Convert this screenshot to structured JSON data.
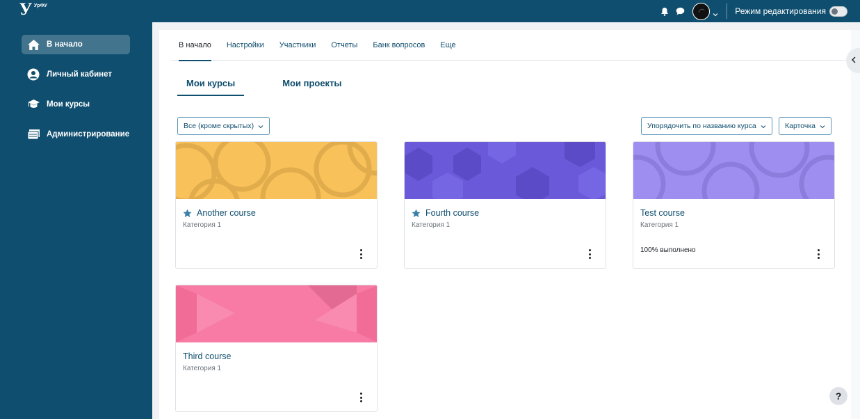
{
  "brand": {
    "mark": "У",
    "name": "УрФУ"
  },
  "topbar": {
    "edit_mode_label": "Режим редактирования"
  },
  "sidebar": {
    "items": [
      {
        "label": "В начало",
        "icon": "home-icon",
        "active": true
      },
      {
        "label": "Личный кабинет",
        "icon": "user-icon",
        "active": false
      },
      {
        "label": "Мои курсы",
        "icon": "graduation-cap-icon",
        "active": false
      },
      {
        "label": "Администрирование",
        "icon": "admin-icon",
        "active": false
      }
    ]
  },
  "secondary_nav": {
    "tabs": [
      {
        "label": "В начало",
        "active": true
      },
      {
        "label": "Настройки",
        "active": false
      },
      {
        "label": "Участники",
        "active": false
      },
      {
        "label": "Отчеты",
        "active": false
      },
      {
        "label": "Банк вопросов",
        "active": false
      },
      {
        "label": "Еще",
        "active": false
      }
    ]
  },
  "subtabs": [
    {
      "label": "Мои курсы",
      "active": true
    },
    {
      "label": "Мои проекты",
      "active": false
    }
  ],
  "filters": {
    "grouping": "Все (кроме скрытых)",
    "sort": "Упорядочить по названию курса",
    "view": "Карточка"
  },
  "courses": [
    {
      "title": "Another course",
      "category": "Категория 1",
      "starred": true,
      "progress": "",
      "color": "#f9c15a"
    },
    {
      "title": "Fourth course",
      "category": "Категория 1",
      "starred": true,
      "progress": "",
      "color": "#6a5ad9"
    },
    {
      "title": "Test course",
      "category": "Категория 1",
      "starred": false,
      "progress": "100% выполнено",
      "color": "#9d8ef0"
    },
    {
      "title": "Third course",
      "category": "Категория 1",
      "starred": false,
      "progress": "",
      "color": "#f77ba4"
    }
  ],
  "help": {
    "label": "?"
  },
  "colors": {
    "primary": "#0f4e6e",
    "star": "#3a7fa8"
  }
}
